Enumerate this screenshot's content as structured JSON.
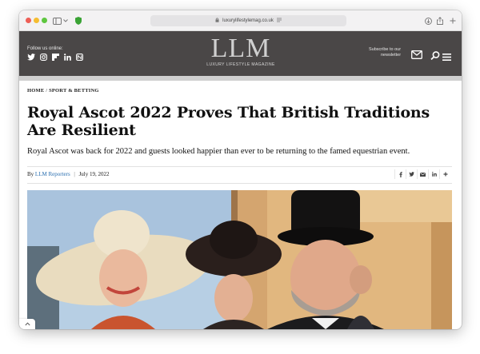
{
  "browser": {
    "url": "luxurylifestylemag.co.uk",
    "icons": [
      "sidebar-icon",
      "chevron-down-icon",
      "shield-icon",
      "lock-icon",
      "download-icon",
      "share-icon",
      "new-tab-icon"
    ]
  },
  "header": {
    "follow_label": "Follow us online:",
    "social_icons": [
      "twitter-icon",
      "instagram-icon",
      "flipboard-icon",
      "linkedin-icon",
      "news-icon"
    ],
    "logo_mark": "LLM",
    "logo_sub": "LUXURY LIFESTYLE MAGAZINE",
    "subscribe_line1": "Subscribe to our",
    "subscribe_line2": "newsletter",
    "colors": {
      "bar": "#4a4747",
      "subbar": "#cfcfcf"
    }
  },
  "article": {
    "breadcrumb_home": "HOME",
    "breadcrumb_sep": "/",
    "breadcrumb_section": "SPORT & BETTING",
    "headline": "Royal Ascot 2022 Proves That British Traditions Are Resilient",
    "standfirst": "Royal Ascot was back for 2022 and guests looked happier than ever to be returning to the famed equestrian event.",
    "by_label": "By",
    "author": "LLM Reporters",
    "date": "July 19, 2022",
    "share_icons": [
      "facebook-icon",
      "twitter-icon",
      "email-icon",
      "linkedin-icon",
      "plus-icon"
    ],
    "author_color": "#2a6fb0"
  }
}
